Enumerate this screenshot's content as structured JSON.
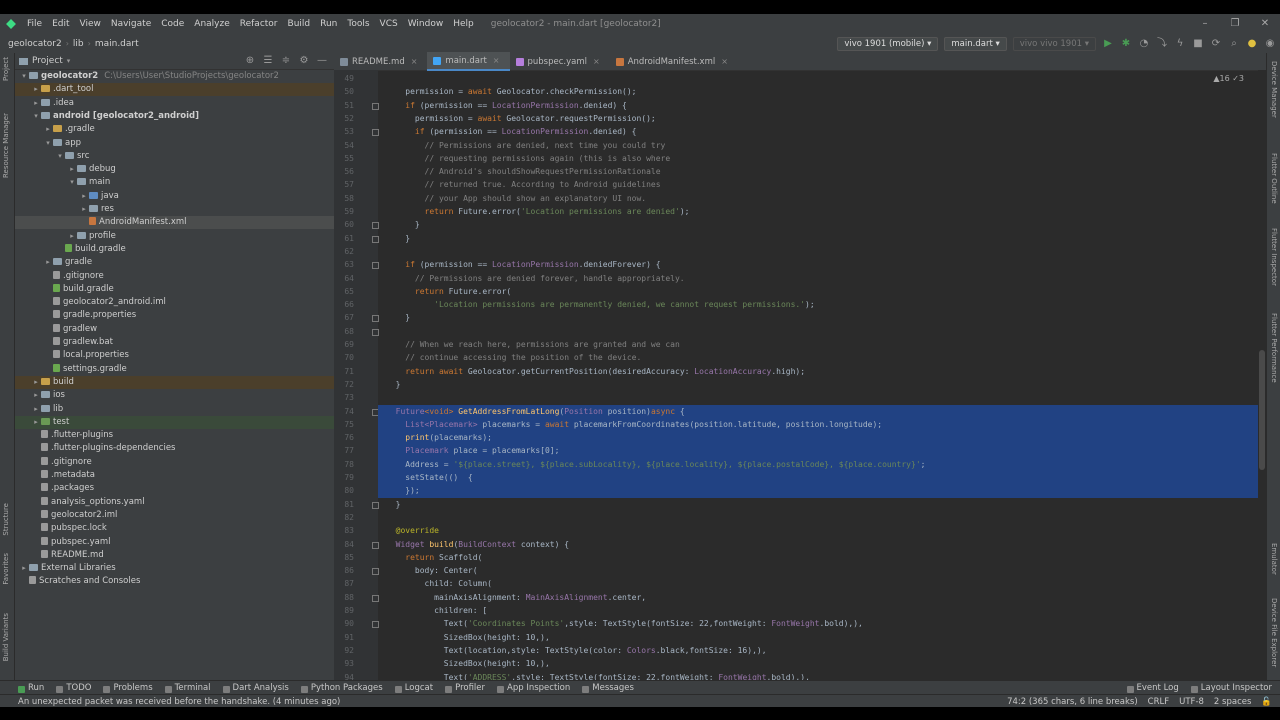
{
  "menubar": {
    "items": [
      "File",
      "Edit",
      "View",
      "Navigate",
      "Code",
      "Analyze",
      "Refactor",
      "Build",
      "Run",
      "Tools",
      "VCS",
      "Window",
      "Help"
    ],
    "title": "geolocator2 - main.dart [geolocator2]"
  },
  "navbar": {
    "breadcrumbs": [
      "geolocator2",
      "lib",
      "main.dart"
    ],
    "device": "vivo 1901 (mobile)",
    "run_config": "main.dart",
    "device2": "vivo vivo 1901"
  },
  "left_strip": [
    "Project",
    "Resource Manager",
    "Structure",
    "Favorites",
    "Build Variants"
  ],
  "right_strip": [
    "Device Manager",
    "Flutter Outline",
    "Flutter Inspector",
    "Flutter Performance",
    "Emulator",
    "Device File Explorer"
  ],
  "project": {
    "header": "Project",
    "rows": [
      {
        "label": "geolocator2",
        "path": "C:\\Users\\User\\StudioProjects\\geolocator2",
        "indent": 0,
        "arrow": "▾",
        "icon": "folder",
        "bold": true
      },
      {
        "label": ".dart_tool",
        "indent": 1,
        "arrow": "▸",
        "icon": "folder-y",
        "cls": "ex"
      },
      {
        "label": ".idea",
        "indent": 1,
        "arrow": "▸",
        "icon": "folder"
      },
      {
        "label": "android [geolocator2_android]",
        "indent": 1,
        "arrow": "▾",
        "icon": "folder",
        "bold": true
      },
      {
        "label": ".gradle",
        "indent": 2,
        "arrow": "▸",
        "icon": "folder-y"
      },
      {
        "label": "app",
        "indent": 2,
        "arrow": "▾",
        "icon": "folder"
      },
      {
        "label": "src",
        "indent": 3,
        "arrow": "▾",
        "icon": "folder"
      },
      {
        "label": "debug",
        "indent": 4,
        "arrow": "▸",
        "icon": "folder"
      },
      {
        "label": "main",
        "indent": 4,
        "arrow": "▾",
        "icon": "folder"
      },
      {
        "label": "java",
        "indent": 5,
        "arrow": "▸",
        "icon": "folder-b"
      },
      {
        "label": "res",
        "indent": 5,
        "arrow": "▸",
        "icon": "folder"
      },
      {
        "label": "AndroidManifest.xml",
        "indent": 5,
        "arrow": "",
        "icon": "file-x",
        "cls": "sel"
      },
      {
        "label": "profile",
        "indent": 4,
        "arrow": "▸",
        "icon": "folder"
      },
      {
        "label": "build.gradle",
        "indent": 3,
        "arrow": "",
        "icon": "file-g"
      },
      {
        "label": "gradle",
        "indent": 2,
        "arrow": "▸",
        "icon": "folder"
      },
      {
        "label": ".gitignore",
        "indent": 2,
        "arrow": "",
        "icon": "file"
      },
      {
        "label": "build.gradle",
        "indent": 2,
        "arrow": "",
        "icon": "file-g"
      },
      {
        "label": "geolocator2_android.iml",
        "indent": 2,
        "arrow": "",
        "icon": "file"
      },
      {
        "label": "gradle.properties",
        "indent": 2,
        "arrow": "",
        "icon": "file"
      },
      {
        "label": "gradlew",
        "indent": 2,
        "arrow": "",
        "icon": "file"
      },
      {
        "label": "gradlew.bat",
        "indent": 2,
        "arrow": "",
        "icon": "file"
      },
      {
        "label": "local.properties",
        "indent": 2,
        "arrow": "",
        "icon": "file"
      },
      {
        "label": "settings.gradle",
        "indent": 2,
        "arrow": "",
        "icon": "file-g"
      },
      {
        "label": "build",
        "indent": 1,
        "arrow": "▸",
        "icon": "folder-y",
        "cls": "ex"
      },
      {
        "label": "ios",
        "indent": 1,
        "arrow": "▸",
        "icon": "folder"
      },
      {
        "label": "lib",
        "indent": 1,
        "arrow": "▸",
        "icon": "folder"
      },
      {
        "label": "test",
        "indent": 1,
        "arrow": "▸",
        "icon": "folder-g",
        "cls": "ex2"
      },
      {
        "label": ".flutter-plugins",
        "indent": 1,
        "arrow": "",
        "icon": "file"
      },
      {
        "label": ".flutter-plugins-dependencies",
        "indent": 1,
        "arrow": "",
        "icon": "file"
      },
      {
        "label": ".gitignore",
        "indent": 1,
        "arrow": "",
        "icon": "file"
      },
      {
        "label": ".metadata",
        "indent": 1,
        "arrow": "",
        "icon": "file"
      },
      {
        "label": ".packages",
        "indent": 1,
        "arrow": "",
        "icon": "file"
      },
      {
        "label": "analysis_options.yaml",
        "indent": 1,
        "arrow": "",
        "icon": "file"
      },
      {
        "label": "geolocator2.iml",
        "indent": 1,
        "arrow": "",
        "icon": "file"
      },
      {
        "label": "pubspec.lock",
        "indent": 1,
        "arrow": "",
        "icon": "file"
      },
      {
        "label": "pubspec.yaml",
        "indent": 1,
        "arrow": "",
        "icon": "file"
      },
      {
        "label": "README.md",
        "indent": 1,
        "arrow": "",
        "icon": "file"
      },
      {
        "label": "External Libraries",
        "indent": 0,
        "arrow": "▸",
        "icon": "folder"
      },
      {
        "label": "Scratches and Consoles",
        "indent": 0,
        "arrow": "",
        "icon": "file"
      }
    ]
  },
  "tabs": [
    {
      "label": "README.md",
      "kind": "md"
    },
    {
      "label": "main.dart",
      "kind": "dart",
      "active": true
    },
    {
      "label": "pubspec.yaml",
      "kind": "yaml"
    },
    {
      "label": "AndroidManifest.xml",
      "kind": "xml"
    }
  ],
  "inspections": "▲16  ✓3",
  "code": {
    "first_line": 49,
    "lines": [
      [
        [
          "",
          ""
        ]
      ],
      [
        [
          "",
          "    permission = "
        ],
        [
          "kw",
          "await "
        ],
        [
          "",
          "Geolocator.checkPermission();"
        ]
      ],
      [
        [
          "kw",
          "    if "
        ],
        [
          "",
          "(permission == "
        ],
        [
          "ty",
          "LocationPermission"
        ],
        [
          "",
          ".denied) {"
        ]
      ],
      [
        [
          "",
          "      permission = "
        ],
        [
          "kw",
          "await "
        ],
        [
          "",
          "Geolocator.requestPermission();"
        ]
      ],
      [
        [
          "kw",
          "      if "
        ],
        [
          "",
          "(permission == "
        ],
        [
          "ty",
          "LocationPermission"
        ],
        [
          "",
          ".denied) {"
        ]
      ],
      [
        [
          "cm",
          "        // Permissions are denied, next time you could try"
        ]
      ],
      [
        [
          "cm",
          "        // requesting permissions again (this is also where"
        ]
      ],
      [
        [
          "cm",
          "        // Android's shouldShowRequestPermissionRationale"
        ]
      ],
      [
        [
          "cm",
          "        // returned true. According to Android guidelines"
        ]
      ],
      [
        [
          "cm",
          "        // your App should show an explanatory UI now."
        ]
      ],
      [
        [
          "kw",
          "        return "
        ],
        [
          "",
          "Future.error("
        ],
        [
          "st",
          "'Location permissions are denied'"
        ],
        [
          "",
          ");"
        ]
      ],
      [
        [
          "",
          "      }"
        ]
      ],
      [
        [
          "",
          "    }"
        ]
      ],
      [
        [
          "",
          ""
        ]
      ],
      [
        [
          "kw",
          "    if "
        ],
        [
          "",
          "(permission == "
        ],
        [
          "ty",
          "LocationPermission"
        ],
        [
          "",
          ".deniedForever) {"
        ]
      ],
      [
        [
          "cm",
          "      // Permissions are denied forever, handle appropriately."
        ]
      ],
      [
        [
          "kw",
          "      return "
        ],
        [
          "",
          "Future.error("
        ]
      ],
      [
        [
          "st",
          "          'Location permissions are permanently denied, we cannot request permissions.'"
        ],
        [
          "",
          ");"
        ]
      ],
      [
        [
          "",
          "    }"
        ]
      ],
      [
        [
          "",
          ""
        ]
      ],
      [
        [
          "cm",
          "    // When we reach here, permissions are granted and we can"
        ]
      ],
      [
        [
          "cm",
          "    // continue accessing the position of the device."
        ]
      ],
      [
        [
          "kw",
          "    return await "
        ],
        [
          "",
          "Geolocator.getCurrentPosition(desiredAccuracy: "
        ],
        [
          "ty",
          "LocationAccuracy"
        ],
        [
          "",
          ".high);"
        ]
      ],
      [
        [
          "",
          "  }"
        ]
      ],
      [
        [
          "",
          ""
        ]
      ],
      [
        [
          "ty",
          "  Future"
        ],
        [
          "kw",
          "<void> "
        ],
        [
          "fn",
          "GetAddressFromLatLong"
        ],
        [
          "",
          "("
        ],
        [
          "ty",
          "Position "
        ],
        [
          "",
          "position)"
        ],
        [
          "kw",
          "async "
        ],
        [
          "",
          "{"
        ]
      ],
      [
        [
          "ty",
          "    List<Placemark> "
        ],
        [
          "",
          "placemarks = "
        ],
        [
          "kw",
          "await "
        ],
        [
          "",
          "placemarkFromCoordinates(position.latitude, position.longitude);"
        ]
      ],
      [
        [
          "fn",
          "    print"
        ],
        [
          "",
          "(placemarks);"
        ]
      ],
      [
        [
          "ty",
          "    Placemark "
        ],
        [
          "",
          "place = placemarks[0];"
        ]
      ],
      [
        [
          "",
          "    Address = "
        ],
        [
          "st",
          "'${place.street}, ${place.subLocality}, ${place.locality}, ${place.postalCode}, ${place.country}'"
        ],
        [
          "",
          ";"
        ]
      ],
      [
        [
          "",
          "    setState(()  {"
        ]
      ],
      [
        [
          "",
          "    });"
        ]
      ],
      [
        [
          "",
          "  }"
        ]
      ],
      [
        [
          "",
          ""
        ]
      ],
      [
        [
          "an",
          "  @override"
        ]
      ],
      [
        [
          "ty",
          "  Widget "
        ],
        [
          "fn",
          "build"
        ],
        [
          "",
          "("
        ],
        [
          "ty",
          "BuildContext "
        ],
        [
          "",
          "context) {"
        ]
      ],
      [
        [
          "kw",
          "    return "
        ],
        [
          "",
          "Scaffold("
        ]
      ],
      [
        [
          "",
          "      body: Center("
        ]
      ],
      [
        [
          "",
          "        child: Column("
        ]
      ],
      [
        [
          "",
          "          mainAxisAlignment: "
        ],
        [
          "ty",
          "MainAxisAlignment"
        ],
        [
          "",
          ".center,"
        ]
      ],
      [
        [
          "",
          "          children: ["
        ]
      ],
      [
        [
          "",
          "            Text("
        ],
        [
          "st",
          "'Coordinates Points'"
        ],
        [
          "",
          ",style: TextStyle(fontSize: 22,fontWeight: "
        ],
        [
          "ty",
          "FontWeight"
        ],
        [
          "",
          ".bold),),"
        ]
      ],
      [
        [
          "",
          "            SizedBox(height: 10,),"
        ]
      ],
      [
        [
          "",
          "            Text(location,style: TextStyle(color: "
        ],
        [
          "ty",
          "Colors"
        ],
        [
          "",
          ".black,fontSize: 16),),"
        ]
      ],
      [
        [
          "",
          "            SizedBox(height: 10,),"
        ]
      ],
      [
        [
          "",
          "            Text("
        ],
        [
          "st",
          "'ADDRESS'"
        ],
        [
          "",
          ",style: TextStyle(fontSize: 22,fontWeight: "
        ],
        [
          "ty",
          "FontWeight"
        ],
        [
          "",
          ".bold),),"
        ]
      ]
    ]
  },
  "bottom_tools": [
    "Run",
    "TODO",
    "Problems",
    "Terminal",
    "Dart Analysis",
    "Python Packages",
    "Logcat",
    "Profiler",
    "App Inspection",
    "Messages"
  ],
  "bottom_right_tools": [
    "Event Log",
    "Layout Inspector"
  ],
  "status": {
    "message": "An unexpected packet was received before the handshake. (4 minutes ago)",
    "position": "74:2 (365 chars, 6 line breaks)",
    "line_sep": "CRLF",
    "encoding": "UTF-8",
    "indent": "2 spaces"
  }
}
